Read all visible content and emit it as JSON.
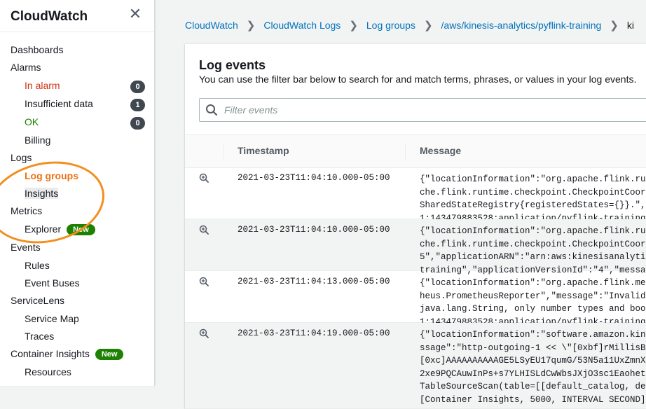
{
  "sidebar": {
    "title": "CloudWatch",
    "close_icon": "close-icon",
    "items": [
      {
        "label": "Dashboards"
      },
      {
        "label": "Alarms"
      },
      {
        "label": "In alarm",
        "count": "0"
      },
      {
        "label": "Insufficient data",
        "count": "1"
      },
      {
        "label": "OK",
        "count": "0"
      },
      {
        "label": "Billing"
      },
      {
        "label": "Logs"
      },
      {
        "label": "Log groups"
      },
      {
        "label": "Insights"
      },
      {
        "label": "Metrics"
      },
      {
        "label": "Explorer",
        "badge": "New"
      },
      {
        "label": "Events"
      },
      {
        "label": "Rules"
      },
      {
        "label": "Event Buses"
      },
      {
        "label": "ServiceLens"
      },
      {
        "label": "Service Map"
      },
      {
        "label": "Traces"
      },
      {
        "label": "Container Insights",
        "badge": "New"
      },
      {
        "label": "Resources"
      }
    ],
    "colors": {
      "alarm": "#d13212",
      "ok": "#1d8102",
      "active": "#ec7211",
      "annotation": "#f28f1f"
    }
  },
  "breadcrumbs": [
    "CloudWatch",
    "CloudWatch Logs",
    "Log groups",
    "/aws/kinesis-analytics/pyflink-training",
    "ki"
  ],
  "panel": {
    "title": "Log events",
    "subtitle": "You can use the filter bar below to search for and match terms, phrases, or values in your log events.",
    "filter_placeholder": "Filter events",
    "columns": {
      "timestamp": "Timestamp",
      "message": "Message"
    },
    "rows": [
      {
        "timestamp": "2021-03-23T11:04:10.000-05:00",
        "message": "{\"locationInformation\":\"org.apache.flink.runt\nche.flink.runtime.checkpoint.CheckpointCoordi\nSharedStateRegistry{registeredStates={}}.\",\"t\n1:143479883528:application/pyflink-training\","
      },
      {
        "timestamp": "2021-03-23T11:04:10.000-05:00",
        "message": "{\"locationInformation\":\"org.apache.flink.runt\nche.flink.runtime.checkpoint.CheckpointCoordi\n5\",\"applicationARN\":\"arn:aws:kinesisanalytics\ntraining\",\"applicationVersionId\":\"4\",\"message"
      },
      {
        "timestamp": "2021-03-23T11:04:13.000-05:00",
        "message": "{\"locationInformation\":\"org.apache.flink.metr\nheus.PrometheusReporter\",\"message\":\"Invalid t\njava.lang.String, only number types and boole\n1:143479883528:application/pyflink-training\","
      },
      {
        "timestamp": "2021-03-23T11:04:19.000-05:00",
        "message": "{\"locationInformation\":\"software.amazon.kines\nssage\":\"http-outgoing-1 << \\\"[0xbf]rMillisBeh\n[0xc]AAAAAAAAAAGE5LSyEU17qumG/53N5a11UxZmnXxj\n2xe9PQCAuwInPs+s7YLHISLdCwWbsJXjO3sc1Eaohet0e\nTableSourceScan(table=[[default_catalog, defa\n[Container Insights, 5000, INTERVAL SECOND]]"
      }
    ]
  }
}
